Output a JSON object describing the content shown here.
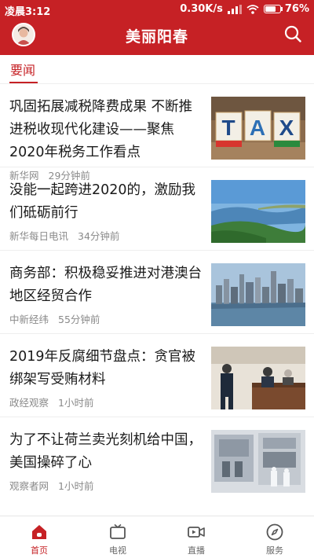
{
  "status_bar": {
    "time": "凌晨3:12",
    "speed": "0.30K/s",
    "battery": "76%",
    "battery_level": 0.76
  },
  "header": {
    "title": "美丽阳春",
    "accent_color": "#c62125"
  },
  "tabs": {
    "active": "要闻"
  },
  "news": [
    {
      "title": "巩固拓展减税降费成果 不断推进税收现代化建设——聚焦2020年税务工作看点",
      "source": "新华网",
      "time": "29分钟前",
      "thumb": "tax-blocks"
    },
    {
      "title": "没能一起跨进2020的，激励我们砥砺前行",
      "source": "新华每日电讯",
      "time": "34分钟前",
      "thumb": "river-landscape"
    },
    {
      "title": "商务部：积极稳妥推进对港澳台地区经贸合作",
      "source": "中新经纬",
      "time": "55分钟前",
      "thumb": "harbor-skyline"
    },
    {
      "title": "2019年反腐细节盘点：贪官被绑架写受贿材料",
      "source": "政经观察",
      "time": "1小时前",
      "thumb": "courtroom"
    },
    {
      "title": "为了不让荷兰卖光刻机给中国，美国操碎了心",
      "source": "观察者网",
      "time": "1小时前",
      "thumb": "lithography-machine"
    }
  ],
  "bottom_nav": [
    {
      "label": "首页",
      "icon": "home-icon",
      "active": true
    },
    {
      "label": "电视",
      "icon": "tv-icon",
      "active": false
    },
    {
      "label": "直播",
      "icon": "live-video-icon",
      "active": false
    },
    {
      "label": "服务",
      "icon": "compass-icon",
      "active": false
    }
  ]
}
